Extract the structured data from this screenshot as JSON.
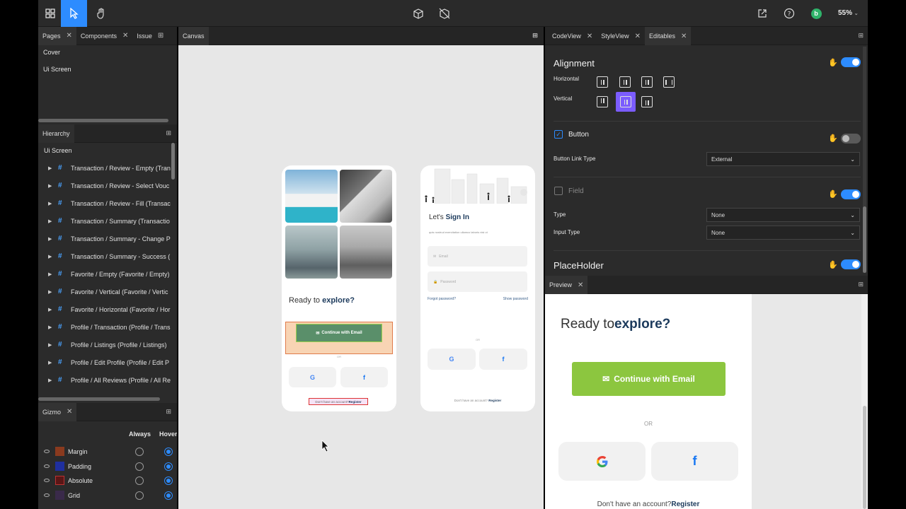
{
  "toolbar": {
    "zoom": "55%",
    "avatar_initial": "b"
  },
  "left_tabs": {
    "pages": "Pages",
    "components": "Components",
    "issue": "Issue"
  },
  "pages": [
    "Cover",
    "Ui Screen"
  ],
  "hierarchy": {
    "title": "Hierarchy",
    "root": "Ui Screen",
    "items": [
      "Transaction / Review - Empty (Tran",
      "Transaction / Review - Select Vouc",
      "Transaction / Review - Fill (Transac",
      "Transaction / Summary  (Transactio",
      "Transaction / Summary - Change P",
      "Transaction / Summary - Success (",
      "Favorite / Empty (Favorite / Empty)",
      "Favorite / Vertical (Favorite / Vertic",
      "Favorite / Horizontal (Favorite / Hor",
      "Profile / Transaction (Profile / Trans",
      "Profile / Listings (Profile / Listings)",
      "Profile / Edit Profile (Profile / Edit P",
      "Profile / All Reviews (Profile / All Re"
    ]
  },
  "gizmo": {
    "title": "Gizmo",
    "col_always": "Always",
    "col_hover": "Hover",
    "rows": [
      {
        "label": "Margin",
        "color": "#8a3a1e"
      },
      {
        "label": "Padding",
        "color": "#1f2f9e"
      },
      {
        "label": "Absolute",
        "color": "#7a1c1c"
      },
      {
        "label": "Grid",
        "color": "#4a2a5e"
      }
    ]
  },
  "canvas": {
    "tab": "Canvas",
    "phone1": {
      "ready": "Ready to ",
      "explore": "explore?",
      "cta": "Continue with Email",
      "or": "OR",
      "footer": "Don't have an account?",
      "register": "Register"
    },
    "phone2": {
      "lets": "Let's ",
      "signin": "Sign In",
      "sub": "quis nostrud exercitation ullamco laboris nisi ut",
      "email_placeholder": "Email",
      "password_placeholder": "Password",
      "forgot": "Forgot password?",
      "show": "Show password",
      "or": "OR",
      "footer": "Don't have an account?",
      "register": "Register"
    }
  },
  "right_tabs": {
    "codeview": "CodeView",
    "styleview": "StyleView",
    "editables": "Editables"
  },
  "editables": {
    "alignment": "Alignment",
    "horizontal": "Horizontal",
    "vertical": "Vertical",
    "button": "Button",
    "button_link_type": "Button Link Type",
    "button_link_value": "External",
    "field": "Field",
    "type": "Type",
    "type_value": "None",
    "input_type": "Input Type",
    "input_type_value": "None",
    "placeholder": "PlaceHolder"
  },
  "preview": {
    "tab": "Preview",
    "ready": "Ready to",
    "explore": "explore?",
    "cta": "Continue with Email",
    "or": "OR",
    "footer": "Don't have an account?",
    "register": "Register"
  },
  "colors": {
    "accent": "#2d8cff",
    "green": "#8cc63f",
    "purple": "#7b5cff"
  }
}
